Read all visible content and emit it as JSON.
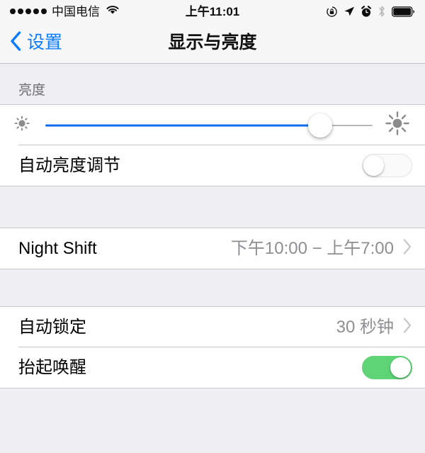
{
  "status_bar": {
    "signal_dots": 5,
    "carrier": "中国电信",
    "wifi_icon": "wifi-icon",
    "time": "上午11:01",
    "right_icons": [
      "rotation-lock-icon",
      "location-arrow-icon",
      "alarm-clock-icon",
      "bluetooth-icon",
      "battery-icon"
    ]
  },
  "nav": {
    "back_label": "设置",
    "back_icon": "chevron-left-icon",
    "title": "显示与亮度"
  },
  "brightness_section": {
    "header": "亮度",
    "slider": {
      "name": "brightness-slider",
      "value_percent": 84,
      "min_icon": "sun-small-icon",
      "max_icon": "sun-large-icon",
      "fill_color": "#0b6cf0"
    },
    "auto_brightness": {
      "label": "自动亮度调节",
      "toggle_state": "off"
    }
  },
  "night_shift_section": {
    "rows": [
      {
        "label": "Night Shift",
        "value": "下午10:00 − 上午7:00",
        "accessory": "chevron-right-icon"
      }
    ]
  },
  "lock_section": {
    "rows": [
      {
        "label": "自动锁定",
        "value": "30 秒钟",
        "accessory": "chevron-right-icon"
      }
    ],
    "raise_to_wake": {
      "label": "抬起唤醒",
      "toggle_state": "on"
    }
  },
  "colors": {
    "tint_blue": "#0b7cff",
    "toggle_on_green": "#5ed477",
    "group_background": "#ffffff",
    "page_background": "#efeef3",
    "secondary_text": "#8e8e93"
  }
}
